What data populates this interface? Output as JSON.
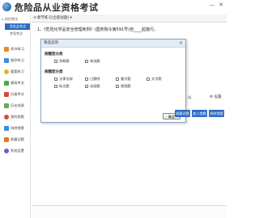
{
  "app": {
    "title": "危险品从业资格考试"
  },
  "window": {
    "minimize": "—",
    "close": "✕"
  },
  "sidebar": {
    "tree_root": "▫ 科目考试",
    "tree_children": [
      {
        "label": "危险品考试",
        "active": true
      },
      {
        "label": "考驾考试",
        "active": false
      }
    ],
    "items": [
      {
        "label": "章节练习",
        "icon": "pencil-icon",
        "color": "#e48a2e"
      },
      {
        "label": "顺序练习",
        "icon": "list-icon",
        "color": "#3a8fd8"
      },
      {
        "label": "重要练习",
        "icon": "star-icon",
        "color": "#e6b12a"
      },
      {
        "label": "模拟考试",
        "icon": "exam-icon",
        "color": "#4aa84a"
      },
      {
        "label": "仿真考试",
        "icon": "paper-icon",
        "color": "#d8463a"
      },
      {
        "label": "历史成绩",
        "icon": "chart-icon",
        "color": "#6aa84f"
      },
      {
        "label": "我的错题",
        "icon": "cross-icon",
        "color": "#d8463a"
      },
      {
        "label": "排除错题",
        "icon": "filter-icon",
        "color": "#3a8fd8"
      },
      {
        "label": "收藏试题",
        "icon": "heart-icon",
        "color": "#e6762a"
      },
      {
        "label": "系统设置",
        "icon": "gear-icon",
        "color": "#7a5ac8"
      }
    ]
  },
  "toolbar": {
    "tab_label": "▾ 章节练习(全部试题) ▾"
  },
  "question": {
    "text": "1、《危险化学品安全管理条例》(国务院令第591号)自____起施行。"
  },
  "dialog": {
    "title": "筛选选项",
    "close": "✕",
    "section1_label": "按题型分类",
    "type_options": [
      "判断题",
      "单选题"
    ],
    "section2_label": "按题型分类",
    "chapter_row1": [
      "法律法规",
      "已删除",
      "重大题",
      "文字题"
    ],
    "chapter_row2": [
      "标志题",
      "动画题",
      "视频题"
    ],
    "ok": "确定"
  },
  "right_panel": {
    "partial_text": "以",
    "settings": "⚙ 设置",
    "buttons": [
      "收藏试题",
      "加入错题",
      "排除错题"
    ]
  }
}
